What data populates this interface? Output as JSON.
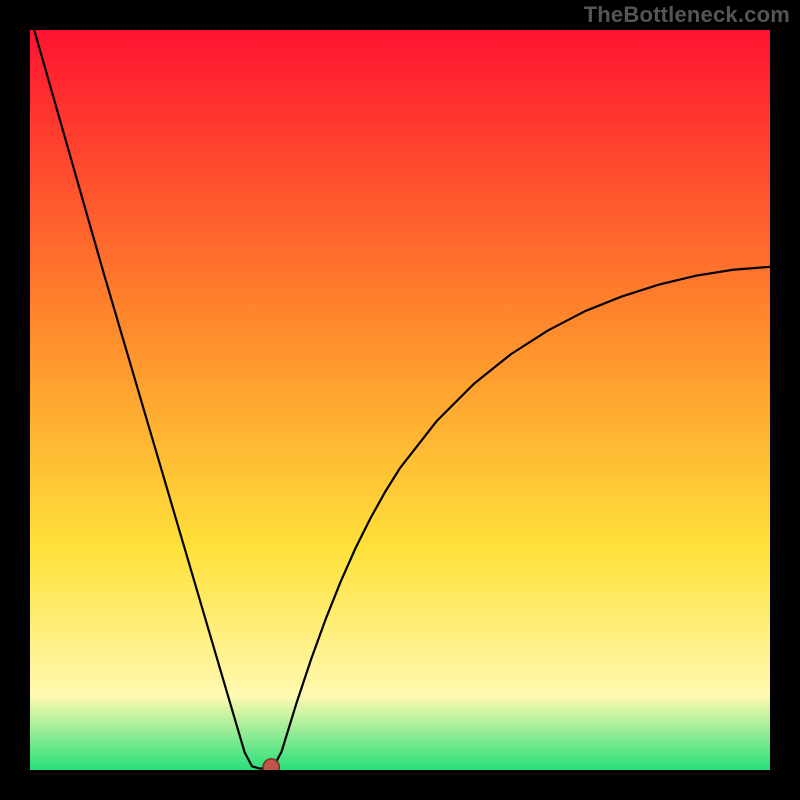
{
  "watermark": "TheBottleneck.com",
  "colors": {
    "bg": "#000000",
    "curve": "#000000",
    "marker_fill": "#c1554c",
    "marker_stroke": "#7a312b",
    "grad_top": "#ff1330",
    "grad_mid1": "#ff8a2c",
    "grad_mid2": "#ffe13a",
    "grad_low": "#fff9b0",
    "grad_bottom": "#27e07a"
  },
  "chart_data": {
    "type": "line",
    "title": "",
    "xlabel": "",
    "ylabel": "",
    "xlim": [
      0,
      100
    ],
    "ylim": [
      0,
      100
    ],
    "x": [
      0,
      2,
      4,
      6,
      8,
      10,
      12,
      14,
      16,
      18,
      20,
      22,
      24,
      26,
      28,
      29,
      30,
      31,
      32,
      33,
      34,
      36,
      38,
      40,
      42,
      44,
      46,
      48,
      50,
      55,
      60,
      65,
      70,
      75,
      80,
      85,
      90,
      95,
      100
    ],
    "values": [
      102,
      95,
      88,
      81,
      74,
      67,
      60.2,
      53.4,
      46.6,
      39.8,
      33,
      26.2,
      19.4,
      12.6,
      5.8,
      2.4,
      0.5,
      0.2,
      0.2,
      0.6,
      2.5,
      9,
      15,
      20.5,
      25.5,
      30,
      34,
      37.6,
      40.8,
      47.2,
      52.2,
      56.2,
      59.4,
      62,
      64,
      65.6,
      66.8,
      67.6,
      68
    ],
    "marker": {
      "x": 32.6,
      "y": 0.4,
      "r": 1.1
    },
    "annotations": []
  }
}
